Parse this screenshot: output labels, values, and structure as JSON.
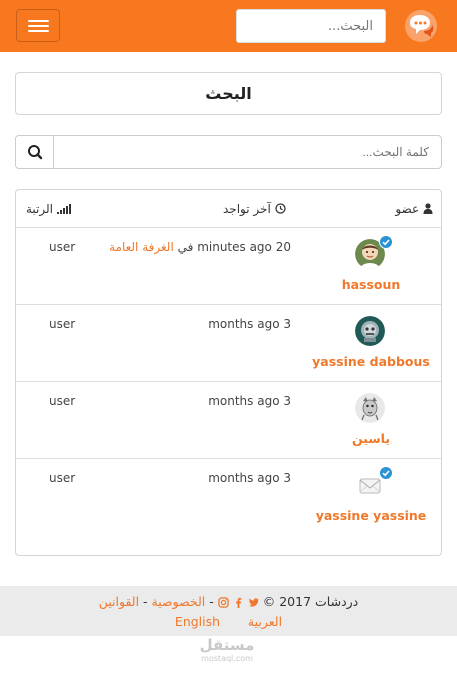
{
  "navbar": {
    "search_placeholder": "البحث...",
    "brand_color": "#f7781f"
  },
  "page": {
    "title": "البحث"
  },
  "search": {
    "placeholder": "كلمة البحث..."
  },
  "table": {
    "headers": {
      "member": "عضو",
      "last_seen": "آخر تواجد",
      "rank": "الرتبة"
    },
    "rows": [
      {
        "username": "hassoun",
        "last_seen": "20 minutes ago",
        "in_word": "في",
        "room": "الغرفة العامة",
        "rank": "user",
        "verified": true,
        "avatar_icon": "cartoon-avatar"
      },
      {
        "username": "yassine dabbous",
        "last_seen": "3 months ago",
        "in_word": "",
        "room": "",
        "rank": "user",
        "verified": false,
        "avatar_icon": "robot-avatar"
      },
      {
        "username": "ياسين",
        "last_seen": "3 months ago",
        "in_word": "",
        "room": "",
        "rank": "user",
        "verified": false,
        "avatar_icon": "animal-avatar"
      },
      {
        "username": "yassine yassine",
        "last_seen": "3 months ago",
        "in_word": "",
        "room": "",
        "rank": "user",
        "verified": true,
        "avatar_icon": "envelope-avatar"
      }
    ]
  },
  "footer": {
    "site_name": "دردشات",
    "year": "2017",
    "copyright_symbol": "©",
    "privacy": "الخصوصية",
    "rules": "القوانين",
    "lang_ar": "العربية",
    "lang_en": "English"
  },
  "watermark": {
    "ar": "مستقل",
    "en": "mostaql.com"
  },
  "colors": {
    "accent": "#f0782a",
    "verified_badge": "#2a93d5"
  }
}
